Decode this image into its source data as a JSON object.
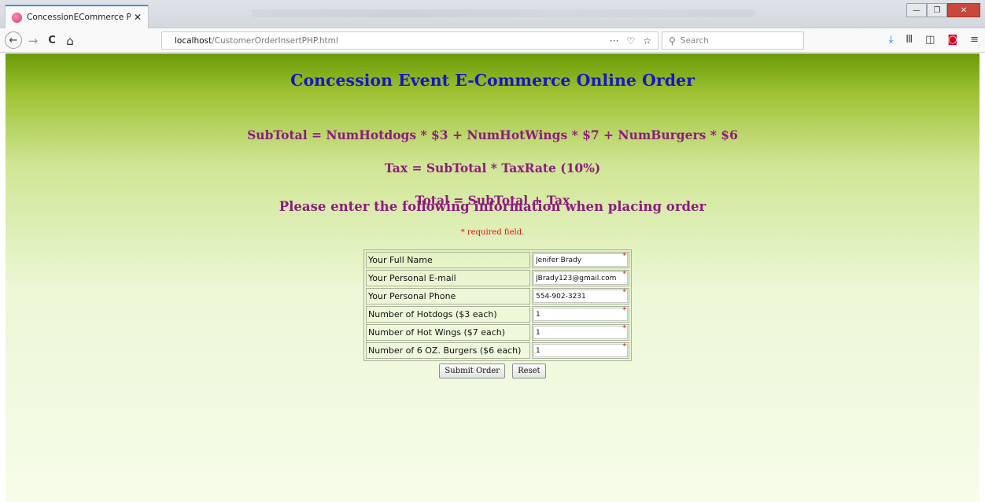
{
  "browser": {
    "tab_title": "ConcessionECommerce Project",
    "tab_close": "✕",
    "url_host": "localhost",
    "url_path": "/CustomerOrderInsertPHP.html",
    "url_info_icon": "ⓘ",
    "search_placeholder": "Search",
    "icons": {
      "back": "←",
      "forward": "→",
      "reload": "C",
      "home": "⌂",
      "more": "···",
      "pocket_small": "♡",
      "bookmark": "☆",
      "search": "🔍",
      "download": "⤓",
      "library": "Ⅲ",
      "sidebar": "◫",
      "pocket": "◙",
      "menu": "≡"
    },
    "window_controls": {
      "minimize": "—",
      "maximize": "❐",
      "close": "✕"
    }
  },
  "page": {
    "title": "Concession Event E-Commerce Online Order",
    "formula_subtotal": "SubTotal = NumHotdogs * $3 + NumHotWings * $7 + NumBurgers * $6",
    "formula_tax": "Tax = SubTotal * TaxRate (10%)",
    "formula_total": "Total = SubTotal + Tax",
    "instructions": "Please enter the following information when placing order",
    "required_note": "* required field.",
    "required_mark": "*",
    "colors": {
      "title": "#1616c4",
      "formula": "#8e1a7f",
      "required": "#dd1111",
      "gradient_top": "#6b9a05",
      "gradient_bottom": "#f6fce9"
    }
  },
  "form": {
    "rows": [
      {
        "label": "Your Full Name",
        "value": "Jenifer Brady"
      },
      {
        "label": "Your Personal E-mail",
        "value": "JBrady123@gmail.com"
      },
      {
        "label": "Your Personal Phone",
        "value": "554-902-3231"
      },
      {
        "label": "Number of Hotdogs ($3 each)",
        "value": "1"
      },
      {
        "label": "Number of Hot Wings ($7 each)",
        "value": "1"
      },
      {
        "label": "Number of 6 OZ. Burgers ($6 each)",
        "value": "1"
      }
    ],
    "submit_label": "Submit Order",
    "reset_label": "Reset"
  }
}
